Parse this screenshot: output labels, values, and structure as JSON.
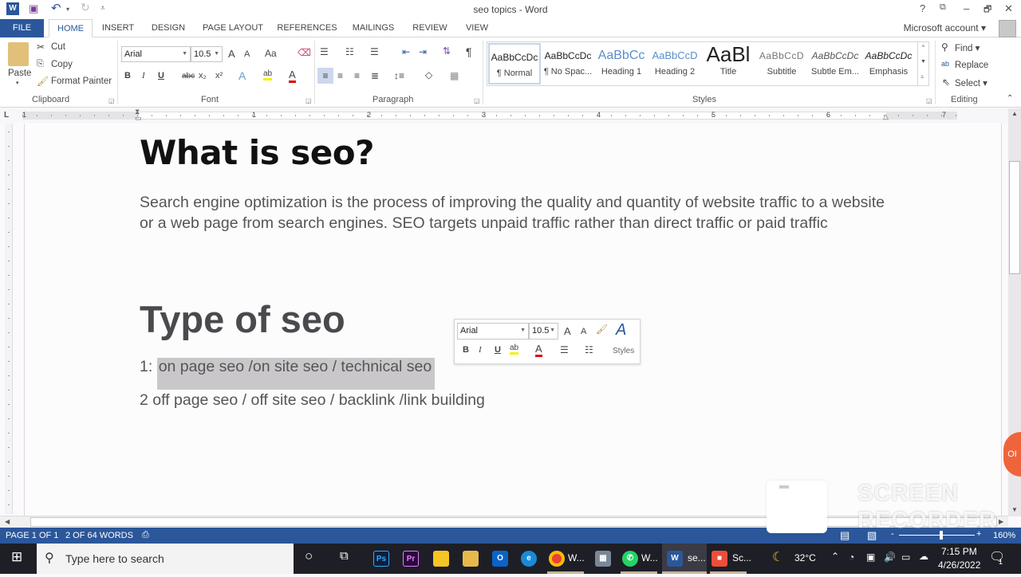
{
  "window": {
    "title": "seo topics - Word",
    "help": "?",
    "ribbon_display": "⧉",
    "minimize": "–",
    "restore": "🗗",
    "close": "✕",
    "account_label": "Microsoft account ▾"
  },
  "quick_access": {
    "word_logo": "W",
    "save": "💾",
    "undo": "↶",
    "undo_dd": "▾",
    "redo": "↻",
    "customize": "⩡"
  },
  "tabs": [
    {
      "label": "FILE"
    },
    {
      "label": "HOME"
    },
    {
      "label": "INSERT"
    },
    {
      "label": "DESIGN"
    },
    {
      "label": "PAGE LAYOUT"
    },
    {
      "label": "REFERENCES"
    },
    {
      "label": "MAILINGS"
    },
    {
      "label": "REVIEW"
    },
    {
      "label": "VIEW"
    }
  ],
  "active_tab": "HOME",
  "ribbon": {
    "clipboard": {
      "label": "Clipboard",
      "paste": "Paste",
      "cut": "Cut",
      "copy": "Copy",
      "format_painter": "Format Painter"
    },
    "font": {
      "label": "Font",
      "font_name": "Arial",
      "font_size": "10.5",
      "grow": "A",
      "shrink": "A",
      "case": "Aa",
      "bold": "B",
      "italic": "I",
      "underline": "U",
      "strike": "abc",
      "subscript": "x₂",
      "superscript": "x²",
      "text_effects": "A",
      "highlight": "ab",
      "font_color": "A"
    },
    "paragraph": {
      "label": "Paragraph",
      "pilcrow": "¶"
    },
    "styles": {
      "label": "Styles",
      "items": [
        {
          "preview": "AaBbCcDc",
          "name": "¶ Normal",
          "selected": true
        },
        {
          "preview": "AaBbCcDc",
          "name": "¶ No Spac..."
        },
        {
          "preview": "AaBbCc",
          "name": "Heading 1"
        },
        {
          "preview": "AaBbCcD",
          "name": "Heading 2"
        },
        {
          "preview": "AaBl",
          "name": "Title"
        },
        {
          "preview": "AaBbCcD",
          "name": "Subtitle"
        },
        {
          "preview": "AaBbCcDc",
          "name": "Subtle Em..."
        },
        {
          "preview": "AaBbCcDc",
          "name": "Emphasis"
        }
      ]
    },
    "editing": {
      "label": "Editing",
      "find": "Find ▾",
      "replace": "Replace",
      "select": "Select ▾"
    }
  },
  "ruler": {
    "tab_selector": "L",
    "numbers": [
      "1",
      "1",
      "2",
      "3",
      "4",
      "5",
      "6",
      "7"
    ]
  },
  "document": {
    "heading1": "What is seo?",
    "paragraph": "Search engine optimization is the process of improving the quality and quantity of website traffic to a website or a web page from search engines. SEO targets unpaid traffic rather than direct traffic or paid traffic",
    "heading2": "Type of seo",
    "item1_prefix": "1: ",
    "item1_selected": "on page seo /on site seo / technical seo",
    "item2": "2 off page seo / off site seo / backlink /link building"
  },
  "mini_toolbar": {
    "font_name": "Arial",
    "font_size": "10.5",
    "bold": "B",
    "italic": "I",
    "underline": "U",
    "styles_label": "Styles"
  },
  "status": {
    "page": "PAGE 1 OF 1",
    "words": "2 OF 64 WORDS",
    "zoom": "160%",
    "zoom_minus": "-",
    "zoom_plus": "+"
  },
  "taskbar": {
    "search_placeholder": "Type here to search",
    "apps": [
      {
        "name": "Photoshop",
        "glyph": "Ps",
        "color": "#0e1f3c",
        "fg": "#31a8ff"
      },
      {
        "name": "Premiere",
        "glyph": "Pr",
        "color": "#2a0a3e",
        "fg": "#e77cff"
      },
      {
        "name": "Sticky Notes",
        "glyph": "",
        "color": "#f7c325"
      },
      {
        "name": "File Explorer",
        "glyph": "",
        "color": "#e8b94a"
      },
      {
        "name": "Outlook",
        "glyph": "O",
        "color": "#0a64c8"
      },
      {
        "name": "Edge",
        "glyph": "e",
        "color": "#1a8ad6"
      }
    ],
    "chrome_label": "W...",
    "whatsapp_label": "W...",
    "word_label": "se...",
    "screen_rec_label": "Sc...",
    "weather": "32°C",
    "time": "7:15 PM",
    "date": "4/26/2022",
    "notifications": "1"
  },
  "overlay": {
    "recorder_bubble": "OI",
    "watermark_line1": "SCREEN",
    "watermark_line2": "RECORDER"
  }
}
